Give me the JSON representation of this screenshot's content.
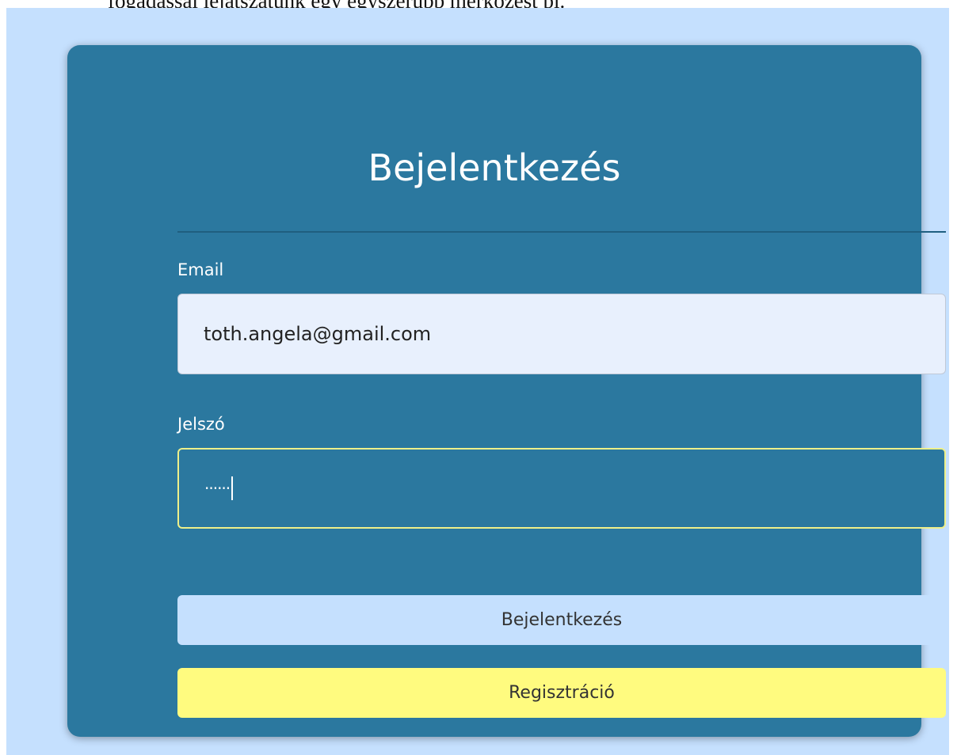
{
  "page": {
    "top_text": "fogadással lejátszatunk egy egyszerűbb mérkőzést pl."
  },
  "login_form": {
    "title": "Bejelentkezés",
    "email": {
      "label": "Email",
      "value": "toth.angela@gmail.com"
    },
    "password": {
      "label": "Jelszó",
      "masked_value": "······"
    },
    "login_button_label": "Bejelentkezés",
    "register_button_label": "Regisztráció"
  },
  "colors": {
    "page_background": "#c5e0fe",
    "card_background": "#2b789f",
    "email_input_background": "#e8f0fd",
    "password_focus_border": "#eef08a",
    "login_button": "#c5e0fe",
    "register_button": "#fffb7f"
  }
}
